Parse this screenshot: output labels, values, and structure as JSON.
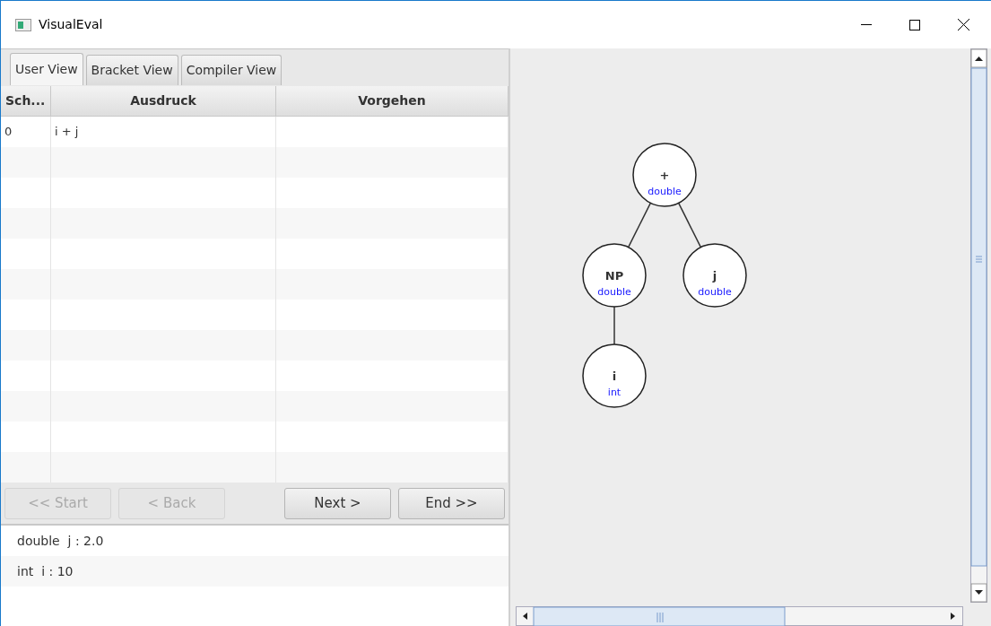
{
  "window": {
    "title": "VisualEval"
  },
  "tabs": [
    {
      "label": "User View",
      "selected": true
    },
    {
      "label": "Bracket View",
      "selected": false
    },
    {
      "label": "Compiler View",
      "selected": false
    }
  ],
  "table": {
    "columns": [
      "Sch...",
      "Ausdruck",
      "Vorgehen"
    ],
    "rows": [
      {
        "step": "0",
        "expression": "i + j"
      }
    ]
  },
  "buttons": [
    {
      "label": "<< Start",
      "disabled": true
    },
    {
      "label": "<  Back",
      "disabled": true
    },
    {
      "label": "Next  >",
      "disabled": false
    },
    {
      "label": "End >>",
      "disabled": false
    }
  ],
  "variables": [
    "double  j : 2.0",
    "int  i : 10"
  ],
  "tree": {
    "label": "+",
    "type": "double",
    "children": [
      {
        "label": "NP",
        "type": "double",
        "children": [
          {
            "label": "i",
            "type": "int"
          }
        ]
      },
      {
        "label": "j",
        "type": "double"
      }
    ]
  }
}
